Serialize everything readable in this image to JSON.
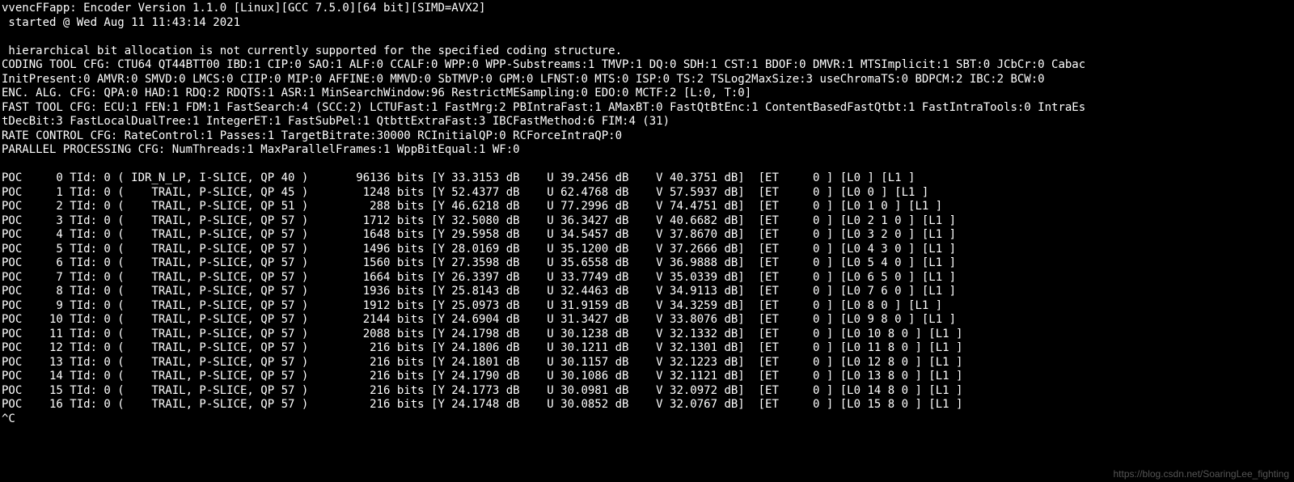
{
  "header": {
    "line1": "vvencFFapp: Encoder Version 1.1.0 [Linux][GCC 7.5.0][64 bit][SIMD=AVX2]",
    "line2": " started @ Wed Aug 11 11:43:14 2021",
    "blank": "",
    "warn": " hierarchical bit allocation is not currently supported for the specified coding structure.",
    "cfg1": "CODING TOOL CFG: CTU64 QT44BTT00 IBD:1 CIP:0 SAO:1 ALF:0 CCALF:0 WPP:0 WPP-Substreams:1 TMVP:1 DQ:0 SDH:1 CST:1 BDOF:0 DMVR:1 MTSImplicit:1 SBT:0 JCbCr:0 Cabac",
    "cfg2": "InitPresent:0 AMVR:0 SMVD:0 LMCS:0 CIIP:0 MIP:0 AFFINE:0 MMVD:0 SbTMVP:0 GPM:0 LFNST:0 MTS:0 ISP:0 TS:2 TSLog2MaxSize:3 useChromaTS:0 BDPCM:2 IBC:2 BCW:0",
    "cfg3": "ENC. ALG. CFG: QPA:0 HAD:1 RDQ:2 RDQTS:1 ASR:1 MinSearchWindow:96 RestrictMESampling:0 EDO:0 MCTF:2 [L:0, T:0]",
    "cfg4": "FAST TOOL CFG: ECU:1 FEN:1 FDM:1 FastSearch:4 (SCC:2) LCTUFast:1 FastMrg:2 PBIntraFast:1 AMaxBT:0 FastQtBtEnc:1 ContentBasedFastQtbt:1 FastIntraTools:0 IntraEs",
    "cfg5": "tDecBit:3 FastLocalDualTree:1 IntegerET:1 FastSubPel:1 QtbttExtraFast:3 IBCFastMethod:6 FIM:4 (31)",
    "cfg6": "RATE CONTROL CFG: RateControl:1 Passes:1 TargetBitrate:30000 RCInitialQP:0 RCForceIntraQP:0",
    "cfg7": "PARALLEL PROCESSING CFG: NumThreads:1 MaxParallelFrames:1 WppBitEqual:1 WF:0"
  },
  "frames": [
    {
      "poc": 0,
      "tid": 0,
      "type": "IDR_N_LP, I-SLICE",
      "qp": 40,
      "bits": 96136,
      "y": "33.3153",
      "u": "39.2456",
      "v": "40.3751",
      "et": 0,
      "l0": "",
      "l1": ""
    },
    {
      "poc": 1,
      "tid": 0,
      "type": "TRAIL, P-SLICE",
      "qp": 45,
      "bits": 1248,
      "y": "52.4377",
      "u": "62.4768",
      "v": "57.5937",
      "et": 0,
      "l0": "0 ",
      "l1": ""
    },
    {
      "poc": 2,
      "tid": 0,
      "type": "TRAIL, P-SLICE",
      "qp": 51,
      "bits": 288,
      "y": "46.6218",
      "u": "77.2996",
      "v": "74.4751",
      "et": 0,
      "l0": "1 0 ",
      "l1": ""
    },
    {
      "poc": 3,
      "tid": 0,
      "type": "TRAIL, P-SLICE",
      "qp": 57,
      "bits": 1712,
      "y": "32.5080",
      "u": "36.3427",
      "v": "40.6682",
      "et": 0,
      "l0": "2 1 0 ",
      "l1": ""
    },
    {
      "poc": 4,
      "tid": 0,
      "type": "TRAIL, P-SLICE",
      "qp": 57,
      "bits": 1648,
      "y": "29.5958",
      "u": "34.5457",
      "v": "37.8670",
      "et": 0,
      "l0": "3 2 0 ",
      "l1": ""
    },
    {
      "poc": 5,
      "tid": 0,
      "type": "TRAIL, P-SLICE",
      "qp": 57,
      "bits": 1496,
      "y": "28.0169",
      "u": "35.1200",
      "v": "37.2666",
      "et": 0,
      "l0": "4 3 0 ",
      "l1": ""
    },
    {
      "poc": 6,
      "tid": 0,
      "type": "TRAIL, P-SLICE",
      "qp": 57,
      "bits": 1560,
      "y": "27.3598",
      "u": "35.6558",
      "v": "36.9888",
      "et": 0,
      "l0": "5 4 0 ",
      "l1": ""
    },
    {
      "poc": 7,
      "tid": 0,
      "type": "TRAIL, P-SLICE",
      "qp": 57,
      "bits": 1664,
      "y": "26.3397",
      "u": "33.7749",
      "v": "35.0339",
      "et": 0,
      "l0": "6 5 0 ",
      "l1": ""
    },
    {
      "poc": 8,
      "tid": 0,
      "type": "TRAIL, P-SLICE",
      "qp": 57,
      "bits": 1936,
      "y": "25.8143",
      "u": "32.4463",
      "v": "34.9113",
      "et": 0,
      "l0": "7 6 0 ",
      "l1": ""
    },
    {
      "poc": 9,
      "tid": 0,
      "type": "TRAIL, P-SLICE",
      "qp": 57,
      "bits": 1912,
      "y": "25.0973",
      "u": "31.9159",
      "v": "34.3259",
      "et": 0,
      "l0": "8 0 ",
      "l1": ""
    },
    {
      "poc": 10,
      "tid": 0,
      "type": "TRAIL, P-SLICE",
      "qp": 57,
      "bits": 2144,
      "y": "24.6904",
      "u": "31.3427",
      "v": "33.8076",
      "et": 0,
      "l0": "9 8 0 ",
      "l1": ""
    },
    {
      "poc": 11,
      "tid": 0,
      "type": "TRAIL, P-SLICE",
      "qp": 57,
      "bits": 2088,
      "y": "24.1798",
      "u": "30.1238",
      "v": "32.1332",
      "et": 0,
      "l0": "10 8 0 ",
      "l1": ""
    },
    {
      "poc": 12,
      "tid": 0,
      "type": "TRAIL, P-SLICE",
      "qp": 57,
      "bits": 216,
      "y": "24.1806",
      "u": "30.1211",
      "v": "32.1301",
      "et": 0,
      "l0": "11 8 0 ",
      "l1": ""
    },
    {
      "poc": 13,
      "tid": 0,
      "type": "TRAIL, P-SLICE",
      "qp": 57,
      "bits": 216,
      "y": "24.1801",
      "u": "30.1157",
      "v": "32.1223",
      "et": 0,
      "l0": "12 8 0 ",
      "l1": ""
    },
    {
      "poc": 14,
      "tid": 0,
      "type": "TRAIL, P-SLICE",
      "qp": 57,
      "bits": 216,
      "y": "24.1790",
      "u": "30.1086",
      "v": "32.1121",
      "et": 0,
      "l0": "13 8 0 ",
      "l1": ""
    },
    {
      "poc": 15,
      "tid": 0,
      "type": "TRAIL, P-SLICE",
      "qp": 57,
      "bits": 216,
      "y": "24.1773",
      "u": "30.0981",
      "v": "32.0972",
      "et": 0,
      "l0": "14 8 0 ",
      "l1": ""
    },
    {
      "poc": 16,
      "tid": 0,
      "type": "TRAIL, P-SLICE",
      "qp": 57,
      "bits": 216,
      "y": "24.1748",
      "u": "30.0852",
      "v": "32.0767",
      "et": 0,
      "l0": "15 8 0 ",
      "l1": ""
    }
  ],
  "tail": "^C",
  "watermark": "https://blog.csdn.net/SoaringLee_fighting"
}
